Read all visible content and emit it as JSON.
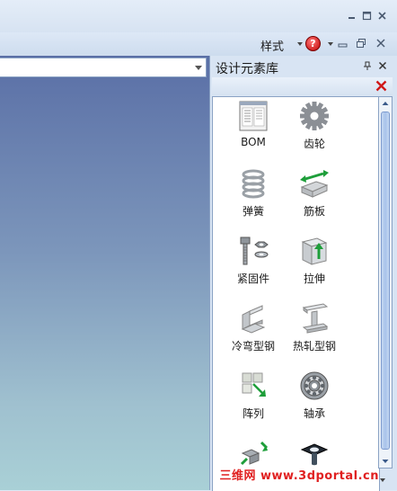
{
  "ribbon": {
    "style_label": "样式"
  },
  "help": {
    "glyph": "?"
  },
  "pane": {
    "title": "设计元素库"
  },
  "items": [
    {
      "label": "BOM",
      "icon": "bom-icon"
    },
    {
      "label": "齿轮",
      "icon": "gear-icon"
    },
    {
      "label": "弹簧",
      "icon": "spring-icon"
    },
    {
      "label": "筋板",
      "icon": "rib-plate-icon"
    },
    {
      "label": "紧固件",
      "icon": "fastener-icon"
    },
    {
      "label": "拉伸",
      "icon": "extrude-icon"
    },
    {
      "label": "冷弯型钢",
      "icon": "cold-formed-steel-icon"
    },
    {
      "label": "热轧型钢",
      "icon": "hot-rolled-steel-icon"
    },
    {
      "label": "阵列",
      "icon": "array-icon"
    },
    {
      "label": "轴承",
      "icon": "bearing-icon"
    },
    {
      "label": "",
      "icon": "transform-icon"
    },
    {
      "label": "",
      "icon": "connector-icon"
    }
  ],
  "watermark": {
    "text": "三维网 www.3dportal.cn"
  },
  "colors": {
    "accent": "#c00000",
    "frame": "#8aa2c4",
    "viewport_top": "#5a6fa6",
    "viewport_bottom": "#a9d0d6"
  }
}
